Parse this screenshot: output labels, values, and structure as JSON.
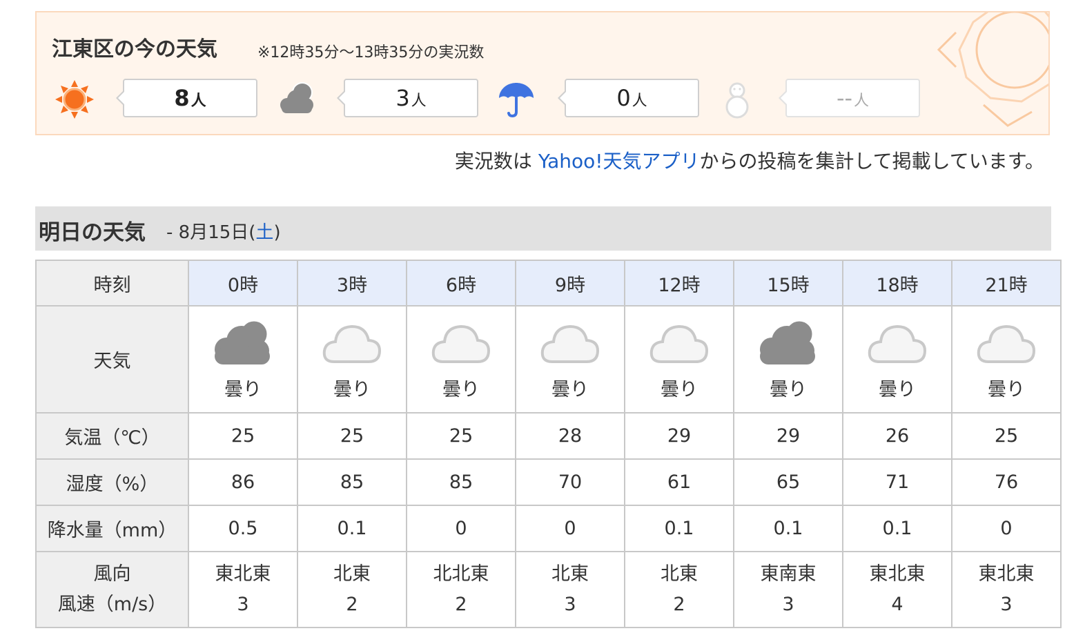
{
  "now": {
    "title": "江東区の今の天気",
    "note": "※12時35分～13時35分の実況数",
    "reports": [
      {
        "icon": "sun-icon",
        "count": "8",
        "unit": "人"
      },
      {
        "icon": "cloud-icon",
        "count": "3",
        "unit": "人"
      },
      {
        "icon": "umbrella-icon",
        "count": "0",
        "unit": "人"
      },
      {
        "icon": "snowman-icon",
        "count": "--",
        "unit": "人"
      }
    ]
  },
  "source": {
    "prefix": "実況数は ",
    "link": "Yahoo!天気アプリ",
    "suffix": "からの投稿を集計して掲載しています。"
  },
  "tomorrow": {
    "title": "明日の天気",
    "date_prefix": "- 8月15日(",
    "dow": "土",
    "date_suffix": ")"
  },
  "table": {
    "headers": {
      "time": "時刻",
      "weather": "天気",
      "temp": "気温（℃）",
      "humidity": "湿度（%）",
      "precip": "降水量（mm）",
      "wind_dir": "風向",
      "wind_speed": "風速（m/s）"
    },
    "columns": [
      {
        "time": "0時",
        "icon": "cloudy-dark-icon",
        "weather": "曇り",
        "temp": "25",
        "humidity": "86",
        "precip": "0.5",
        "wind_dir": "東北東",
        "wind_speed": "3"
      },
      {
        "time": "3時",
        "icon": "cloudy-light-icon",
        "weather": "曇り",
        "temp": "25",
        "humidity": "85",
        "precip": "0.1",
        "wind_dir": "北東",
        "wind_speed": "2"
      },
      {
        "time": "6時",
        "icon": "cloudy-light-icon",
        "weather": "曇り",
        "temp": "25",
        "humidity": "85",
        "precip": "0",
        "wind_dir": "北北東",
        "wind_speed": "2"
      },
      {
        "time": "9時",
        "icon": "cloudy-light-icon",
        "weather": "曇り",
        "temp": "28",
        "humidity": "70",
        "precip": "0",
        "wind_dir": "北東",
        "wind_speed": "3"
      },
      {
        "time": "12時",
        "icon": "cloudy-light-icon",
        "weather": "曇り",
        "temp": "29",
        "humidity": "61",
        "precip": "0.1",
        "wind_dir": "北東",
        "wind_speed": "2"
      },
      {
        "time": "15時",
        "icon": "cloudy-dark-icon",
        "weather": "曇り",
        "temp": "29",
        "humidity": "65",
        "precip": "0.1",
        "wind_dir": "東南東",
        "wind_speed": "3"
      },
      {
        "time": "18時",
        "icon": "cloudy-light-icon",
        "weather": "曇り",
        "temp": "26",
        "humidity": "71",
        "precip": "0.1",
        "wind_dir": "東北東",
        "wind_speed": "4"
      },
      {
        "time": "21時",
        "icon": "cloudy-light-icon",
        "weather": "曇り",
        "temp": "25",
        "humidity": "76",
        "precip": "0",
        "wind_dir": "東北東",
        "wind_speed": "3"
      }
    ]
  },
  "colors": {
    "accent_link": "#1a5fc7",
    "now_bg": "#fff5ec",
    "now_border": "#fbd9bd",
    "sun": "#f6701f",
    "umbrella": "#3f73e0",
    "time_header_bg": "#e6edfb"
  }
}
